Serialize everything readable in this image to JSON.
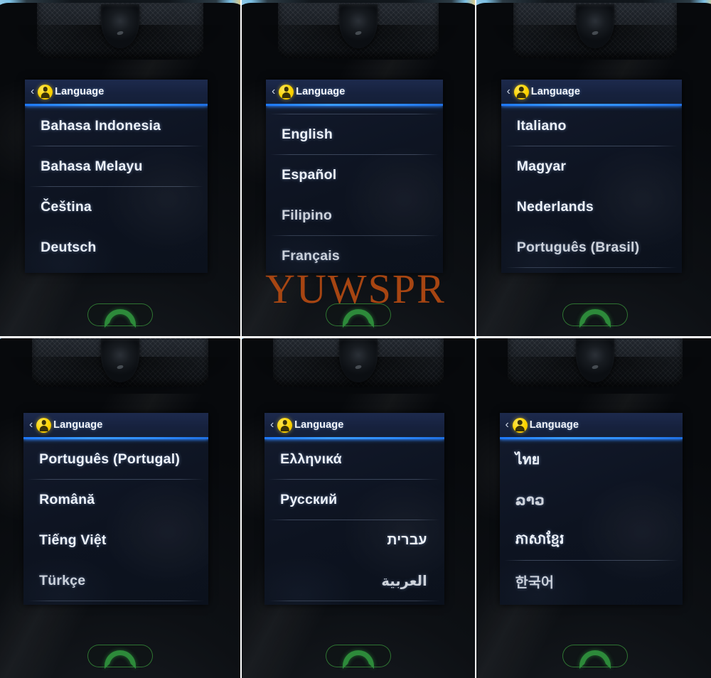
{
  "screen": {
    "title": "Language",
    "back_icon": "chevron-left-icon",
    "badge_icon": "user-avatar-icon",
    "call_key_icon": "phone-handset-icon",
    "accent_color": "#2e8dff",
    "badge_color": "#fdd400",
    "text_color": "#eef3fb",
    "call_key_color": "#2d8a3a"
  },
  "watermark": {
    "text": "YUWSPR",
    "color": "#b44a12"
  },
  "panels": [
    {
      "id": "panel-1",
      "title": "Language",
      "has_top_rule": false,
      "items": [
        {
          "label": "Bahasa Indonesia",
          "separator": true,
          "dim": false
        },
        {
          "label": "Bahasa Melayu",
          "separator": true,
          "dim": false
        },
        {
          "label": "Čeština",
          "separator": false,
          "dim": false
        },
        {
          "label": "Deutsch",
          "separator": false,
          "dim": false
        }
      ]
    },
    {
      "id": "panel-2",
      "title": "Language",
      "has_top_rule": true,
      "items": [
        {
          "label": "English",
          "separator": true,
          "dim": false
        },
        {
          "label": "Español",
          "separator": false,
          "dim": false
        },
        {
          "label": "Filipino",
          "separator": true,
          "dim": true
        },
        {
          "label": "Français",
          "separator": false,
          "dim": true
        }
      ]
    },
    {
      "id": "panel-3",
      "title": "Language",
      "has_top_rule": false,
      "items": [
        {
          "label": "Italiano",
          "separator": true,
          "dim": false
        },
        {
          "label": "Magyar",
          "separator": false,
          "dim": false
        },
        {
          "label": "Nederlands",
          "separator": false,
          "dim": false
        },
        {
          "label": "Português (Brasil)",
          "separator": true,
          "dim": true
        }
      ]
    },
    {
      "id": "panel-4",
      "title": "Language",
      "has_top_rule": false,
      "items": [
        {
          "label": "Português (Portugal)",
          "separator": true,
          "dim": false
        },
        {
          "label": "Română",
          "separator": false,
          "dim": false
        },
        {
          "label": "Tiếng Việt",
          "separator": false,
          "dim": false
        },
        {
          "label": "Türkçe",
          "separator": true,
          "dim": true
        }
      ]
    },
    {
      "id": "panel-5",
      "title": "Language",
      "has_top_rule": false,
      "items": [
        {
          "label": "Ελληνικά",
          "separator": true,
          "dim": false,
          "rtl": false
        },
        {
          "label": "Русский",
          "separator": true,
          "dim": false,
          "rtl": false
        },
        {
          "label": "עברית",
          "separator": false,
          "dim": false,
          "rtl": true
        },
        {
          "label": "العربية",
          "separator": true,
          "dim": true,
          "rtl": true
        }
      ]
    },
    {
      "id": "panel-6",
      "title": "Language",
      "has_top_rule": false,
      "items": [
        {
          "label": "ไทย",
          "separator": false,
          "dim": false
        },
        {
          "label": "ລາວ",
          "separator": false,
          "dim": true
        },
        {
          "label": "ភាសាខ្មែរ",
          "separator": true,
          "dim": false
        },
        {
          "label": "한국어",
          "separator": false,
          "dim": true
        }
      ]
    }
  ]
}
